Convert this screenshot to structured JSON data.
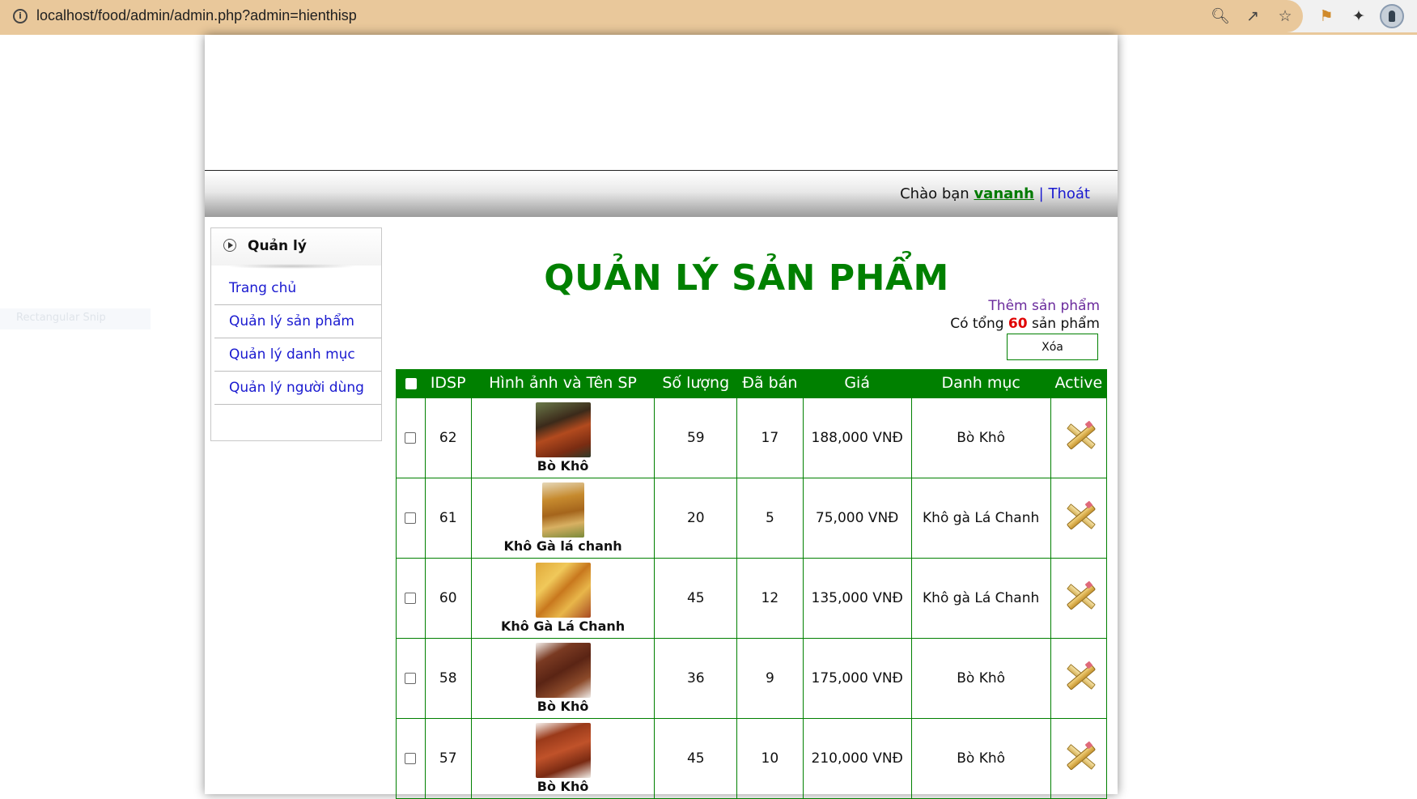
{
  "browser": {
    "url": "localhost/food/admin/admin.php?admin=hienthisp",
    "info_icon": "i"
  },
  "colors": {
    "accent_green": "#008000",
    "link_blue": "#1a1ad0",
    "purple_link": "#6a2a9c",
    "count_red": "#e00000",
    "omnibox": "#e9c89b"
  },
  "ghost_text": "Rectangular Snip",
  "header": {
    "greeting_prefix": "Chào bạn",
    "username": "vananh",
    "separator": "|",
    "logout": "Thoát"
  },
  "sidebar": {
    "title": "Quản lý",
    "items": [
      {
        "label": "Trang chủ"
      },
      {
        "label": "Quản lý sản phẩm"
      },
      {
        "label": "Quản lý danh mục"
      },
      {
        "label": "Quản lý người dùng"
      }
    ]
  },
  "main": {
    "title": "QUẢN LÝ SẢN PHẨM",
    "add_link": "Thêm sản phẩm",
    "total_prefix": "Có tổng",
    "total_count": "60",
    "total_suffix": "sản phẩm",
    "delete_button": "Xóa"
  },
  "table": {
    "headers": [
      "IDSP",
      "Hình ảnh và Tên SP",
      "Số lượng",
      "Đã bán",
      "Giá",
      "Danh mục",
      "Active"
    ],
    "rows": [
      {
        "id": "62",
        "name": "Bò Khô",
        "qty": "59",
        "sold": "17",
        "price": "188,000 VNĐ",
        "category": "Bò Khô"
      },
      {
        "id": "61",
        "name": "Khô Gà lá chanh",
        "qty": "20",
        "sold": "5",
        "price": "75,000 VNĐ",
        "category": "Khô gà Lá Chanh"
      },
      {
        "id": "60",
        "name": "Khô Gà Lá Chanh",
        "qty": "45",
        "sold": "12",
        "price": "135,000 VNĐ",
        "category": "Khô gà Lá Chanh"
      },
      {
        "id": "58",
        "name": "Bò Khô",
        "qty": "36",
        "sold": "9",
        "price": "175,000 VNĐ",
        "category": "Bò Khô"
      },
      {
        "id": "57",
        "name": "Bò Khô",
        "qty": "45",
        "sold": "10",
        "price": "210,000 VNĐ",
        "category": "Bò Khô"
      }
    ]
  }
}
